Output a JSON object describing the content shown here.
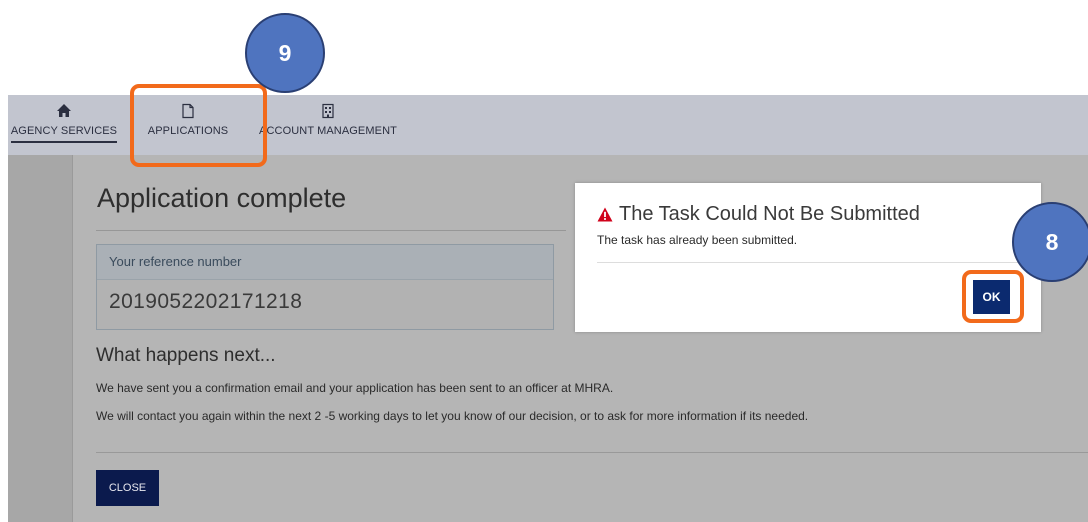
{
  "nav": {
    "items": [
      {
        "label": "AGENCY SERVICES",
        "icon": "home-icon"
      },
      {
        "label": "APPLICATIONS",
        "icon": "document-icon"
      },
      {
        "label": "ACCOUNT MANAGEMENT",
        "icon": "building-icon"
      }
    ]
  },
  "page": {
    "title": "Application complete",
    "reference_label": "Your reference number",
    "reference_number": "2019052202171218",
    "next_heading": "What happens next...",
    "paragraph_1": "We have sent you a confirmation email and your application has been sent to an officer at MHRA.",
    "paragraph_2": "We will contact you again within the next 2 -5 working days to let you know of our decision, or to ask for more information if its needed.",
    "close_label": "CLOSE"
  },
  "modal": {
    "title": "The Task Could Not Be Submitted",
    "message": "The task has already been submitted.",
    "ok_label": "OK",
    "icon": "warning-icon"
  },
  "annotations": {
    "callout_9": "9",
    "callout_8": "8"
  },
  "colors": {
    "accent_orange": "#f26a1b",
    "callout_blue": "#4f74bf",
    "button_navy": "#0b1a4d",
    "warning_red": "#d0021b"
  }
}
